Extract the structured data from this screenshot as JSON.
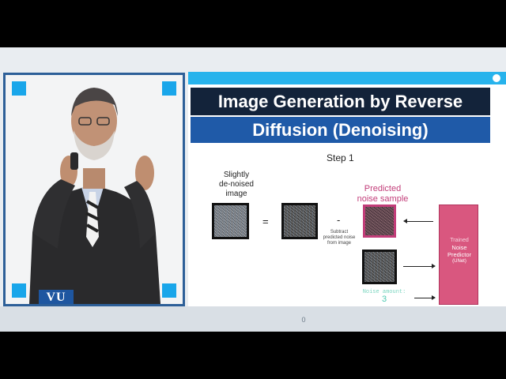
{
  "slide": {
    "title_line1": "Image Generation by Reverse",
    "title_line2": "Diffusion (Denoising)",
    "step_label": "Step 1",
    "slightly_denoised_label": "Slightly\nde-noised\nimage",
    "predicted_noise_label": "Predicted\nnoise sample",
    "equals": "=",
    "minus": "-",
    "subtract_caption": "Subtract\npredicted noise\nfrom image",
    "noise_amount_label": "Noise amount:",
    "noise_amount_value": "3",
    "unet_trained": "Trained",
    "unet_name": "Noise\nPredictor",
    "unet_sub": "(UNet)"
  },
  "logo": {
    "text": "VU"
  },
  "footer": {
    "page_number": "0"
  },
  "colors": {
    "accent_blue": "#27b3ec",
    "title_dark": "#13233a",
    "title_blue": "#1f5aa8",
    "unet_pink": "#d9577f",
    "label_pink": "#c23d79"
  }
}
